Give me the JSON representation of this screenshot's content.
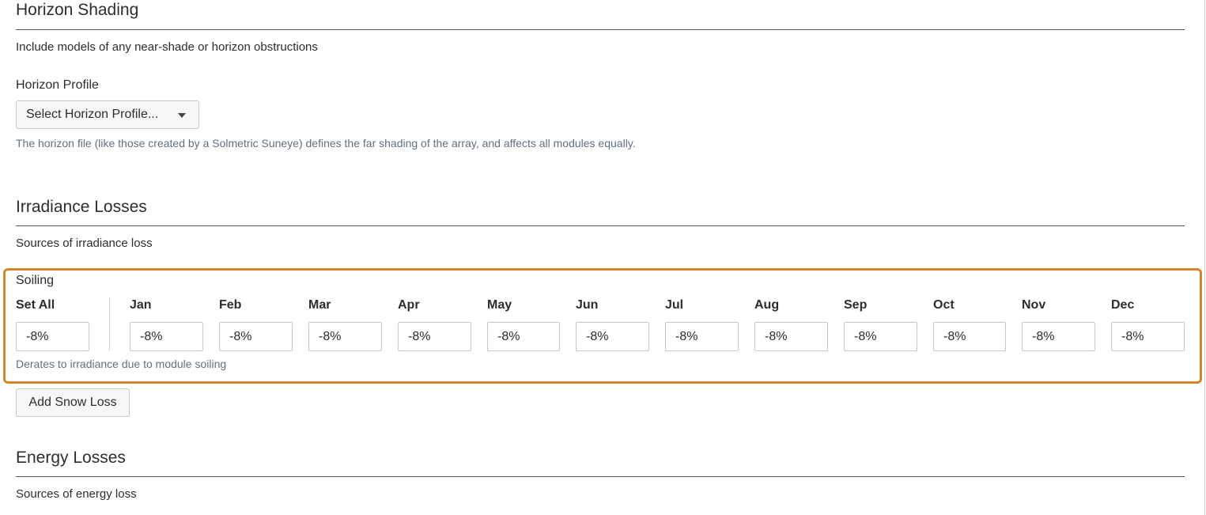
{
  "horizon": {
    "title": "Horizon Shading",
    "description": "Include models of any near-shade or horizon obstructions",
    "profile_label": "Horizon Profile",
    "select_value": "Select Horizon Profile...",
    "help": "The horizon file (like those created by a Solmetric Suneye) defines the far shading of the array, and affects all modules equally."
  },
  "irradiance": {
    "title": "Irradiance Losses",
    "description": "Sources of irradiance loss"
  },
  "soiling": {
    "title": "Soiling",
    "set_all_label": "Set All",
    "set_all_value": "-8%",
    "months": [
      {
        "label": "Jan",
        "value": "-8%"
      },
      {
        "label": "Feb",
        "value": "-8%"
      },
      {
        "label": "Mar",
        "value": "-8%"
      },
      {
        "label": "Apr",
        "value": "-8%"
      },
      {
        "label": "May",
        "value": "-8%"
      },
      {
        "label": "Jun",
        "value": "-8%"
      },
      {
        "label": "Jul",
        "value": "-8%"
      },
      {
        "label": "Aug",
        "value": "-8%"
      },
      {
        "label": "Sep",
        "value": "-8%"
      },
      {
        "label": "Oct",
        "value": "-8%"
      },
      {
        "label": "Nov",
        "value": "-8%"
      },
      {
        "label": "Dec",
        "value": "-8%"
      }
    ],
    "help": "Derates to irradiance due to module soiling",
    "highlight_color": "#d4872a"
  },
  "snow": {
    "add_label": "Add Snow Loss"
  },
  "energy": {
    "title": "Energy Losses",
    "description": "Sources of energy loss"
  }
}
